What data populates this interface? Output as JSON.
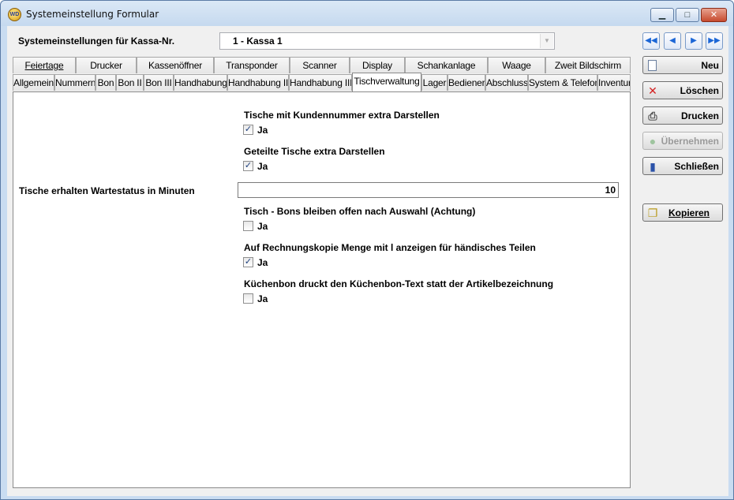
{
  "window": {
    "title": "Systemeinstellung Formular"
  },
  "header": {
    "kassa_label": "Systemeinstellungen für Kassa-Nr.",
    "kassa_value": "1 - Kassa 1"
  },
  "tabs_row1": [
    "Feiertage",
    "Drucker",
    "Kassenöffner",
    "Transponder",
    "Scanner",
    "Display",
    "Schankanlage",
    "Waage",
    "Zweit Bildschirm"
  ],
  "tabs_row2": [
    "Allgemein",
    "Nummern",
    "Bon",
    "Bon II",
    "Bon III",
    "Handhabung",
    "Handhabung II",
    "Handhabung III",
    "Tischverwaltung",
    "Lager",
    "Bediener",
    "Abschluss",
    "System & Telefon",
    "Inventur"
  ],
  "active_tab": "Tischverwaltung",
  "settings": [
    {
      "title": "Tische mit Kundennummer extra Darstellen",
      "checkbox_label": "Ja",
      "checked": true
    },
    {
      "title": "Geteilte Tische extra Darstellen",
      "checkbox_label": "Ja",
      "checked": true
    },
    {
      "title": "Tisch - Bons bleiben offen nach Auswahl (Achtung)",
      "checkbox_label": "Ja",
      "checked": false
    },
    {
      "title": "Auf Rechnungskopie Menge mit l anzeigen für händisches Teilen",
      "checkbox_label": "Ja",
      "checked": true
    },
    {
      "title": "Küchenbon druckt den Küchenbon-Text statt der Artikelbezeichnung",
      "checkbox_label": "Ja",
      "checked": false
    }
  ],
  "wartestatus": {
    "label": "Tische erhalten Wartestatus in Minuten",
    "value": "10"
  },
  "buttons": {
    "neu": "Neu",
    "loeschen": "Löschen",
    "drucken": "Drucken",
    "uebernehmen": "Übernehmen",
    "schliessen": "Schließen",
    "kopieren": "Kopieren"
  },
  "colors": {
    "titlebar": "#c5d9ef",
    "close": "#c64a2e",
    "nav_arrow": "#1b66d6",
    "delete_icon": "#d42020"
  }
}
